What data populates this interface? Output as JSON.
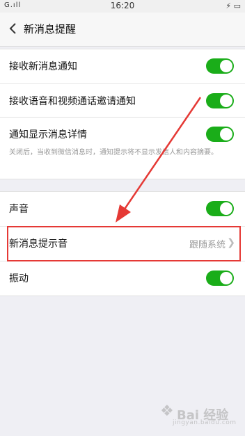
{
  "status_bar": {
    "carrier": "G.ıll",
    "time": "16:20",
    "right": "⚡ ▭"
  },
  "nav": {
    "title": "新消息提醒"
  },
  "section1": {
    "rows": [
      {
        "label": "接收新消息通知",
        "toggle": true
      },
      {
        "label": "接收语音和视频通话邀请通知",
        "toggle": true
      }
    ]
  },
  "section2": {
    "row": {
      "label": "通知显示消息详情",
      "toggle": true
    },
    "description": "关闭后，当收到微信消息时，通知提示将不显示发信人和内容摘要。"
  },
  "section3": {
    "rows": [
      {
        "label": "声音",
        "toggle": true
      },
      {
        "label": "新消息提示音",
        "value": "跟随系统"
      },
      {
        "label": "振动",
        "toggle": true
      }
    ]
  },
  "watermark": {
    "text": "Bai 经验",
    "url": "jingyan.baidu.com"
  },
  "colors": {
    "toggle_on": "#1aad19",
    "annotation": "#e53935"
  }
}
